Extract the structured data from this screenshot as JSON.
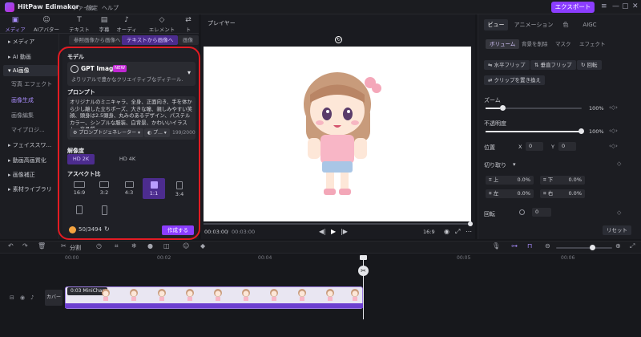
{
  "app": {
    "name": "HitPaw Edimakor",
    "menus": [
      "ファイル",
      "設定",
      "ヘルプ"
    ],
    "export_label": "エクスポート",
    "colors": {
      "accent": "#8b3dff",
      "highlight": "#e31b23"
    }
  },
  "tool_tabs": [
    {
      "label": "メディア",
      "icon": "media-icon"
    },
    {
      "label": "AIアバター",
      "icon": "avatar-icon"
    },
    {
      "label": "テキスト",
      "icon": "text-icon"
    },
    {
      "label": "字幕",
      "icon": "subtitle-icon"
    },
    {
      "label": "オーディオ",
      "icon": "audio-icon"
    },
    {
      "label": "エレメント",
      "icon": "element-icon"
    },
    {
      "label": "ト",
      "icon": "transition-icon"
    }
  ],
  "media_sidebar": [
    {
      "label": "メディア"
    },
    {
      "label": "AI 動画"
    },
    {
      "label": "AI画像"
    },
    {
      "label": "写真 エフェクト"
    },
    {
      "label": "画像生成"
    },
    {
      "label": "画像編集"
    },
    {
      "label": "マイプロジ..."
    },
    {
      "label": "フェイススワ..."
    },
    {
      "label": "動画高画質化"
    },
    {
      "label": "画像補正"
    },
    {
      "label": "素材ライブラリ"
    }
  ],
  "gen": {
    "tabs": [
      "参照画像から画像へ",
      "テキストから画像へ",
      "画像ス"
    ],
    "model_label": "モデル",
    "model_name": "GPT Image 2",
    "model_badge": "NEW",
    "model_desc": "よりリアルで豊かなクリエイティブなディテール...",
    "prompt_label": "プロンプト",
    "prompt_text": "オリジナルのミニキャラ、全身、正面向き、手を体から少し離した立ちポーズ、大きな瞳、親しみやすい笑顔、頭身は2.5頭身、丸みのあるデザイン、パステルカラー、シンプルな服装、白背景、かわいいイラスト、高品質",
    "prompt_gen_label": "プロンプトジェネレーター",
    "style_label": "プ...",
    "char_count": "199/2000",
    "resolution_label": "解像度",
    "resolutions": [
      "HD 2K",
      "HD 4K"
    ],
    "aspect_label": "アスペクト比",
    "ratios": [
      "16:9",
      "3:2",
      "4:3",
      "1:1",
      "3:4",
      "",
      ""
    ],
    "credits": "50/3494",
    "create_label": "作成する"
  },
  "player": {
    "title": "プレイヤー",
    "time_current": "00:03:00",
    "time_total": "00:03:00",
    "aspect": "16:9"
  },
  "right": {
    "tabs": [
      "ビュー",
      "アニメーション",
      "色",
      "AIGC"
    ],
    "subtabs": [
      "ボリューム",
      "背景を削除",
      "マスク",
      "エフェクト"
    ],
    "buttons": [
      "水平フリップ",
      "垂直フリップ",
      "回転",
      "クリップを置き換え"
    ],
    "zoom_label": "ズーム",
    "zoom_value": "100%",
    "zoom_level": 1.0,
    "opacity_label": "不透明度",
    "opacity_value": "100%",
    "opacity_level": 1.0,
    "position_label": "位置",
    "pos_x_label": "X",
    "pos_x": "0",
    "pos_y_label": "Y",
    "pos_y": "0",
    "crop_label": "切り取り",
    "crop": [
      {
        "label": "上",
        "value": "0.0%"
      },
      {
        "label": "下",
        "value": "0.0%"
      },
      {
        "label": "左",
        "value": "0.0%"
      },
      {
        "label": "右",
        "value": "0.0%"
      }
    ],
    "rotate_label": "回転",
    "rotate_value": "0",
    "reset_label": "リセット"
  },
  "timeline": {
    "split_label": "分割",
    "ruler": [
      "00:00",
      "00:02",
      "00:04",
      "00:05",
      "00:06"
    ],
    "clip_label": "0:03 MiniChar",
    "cover_label": "カバー"
  }
}
